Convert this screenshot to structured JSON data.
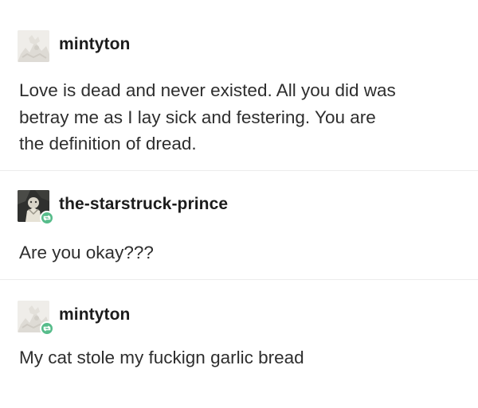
{
  "posts": [
    {
      "username": "mintyton",
      "reblog": false,
      "avatar": "pale-avatar",
      "lines": [
        "Love is dead and never existed. All you did was",
        "betray me as I lay sick and festering. You are",
        "the definition of dread."
      ]
    },
    {
      "username": "the-starstruck-prince",
      "reblog": true,
      "avatar": "dark-avatar",
      "lines": [
        "Are you okay???"
      ]
    },
    {
      "username": "mintyton",
      "reblog": true,
      "avatar": "pale-avatar",
      "lines": [
        "My cat stole my fuckign garlic bread"
      ]
    }
  ],
  "colors": {
    "text": "#2e2e2e",
    "username": "#1c1c1c",
    "divider": "#ececec",
    "reblog_badge": "#56bc8a"
  },
  "icons": {
    "reblog": "reblog-icon"
  }
}
